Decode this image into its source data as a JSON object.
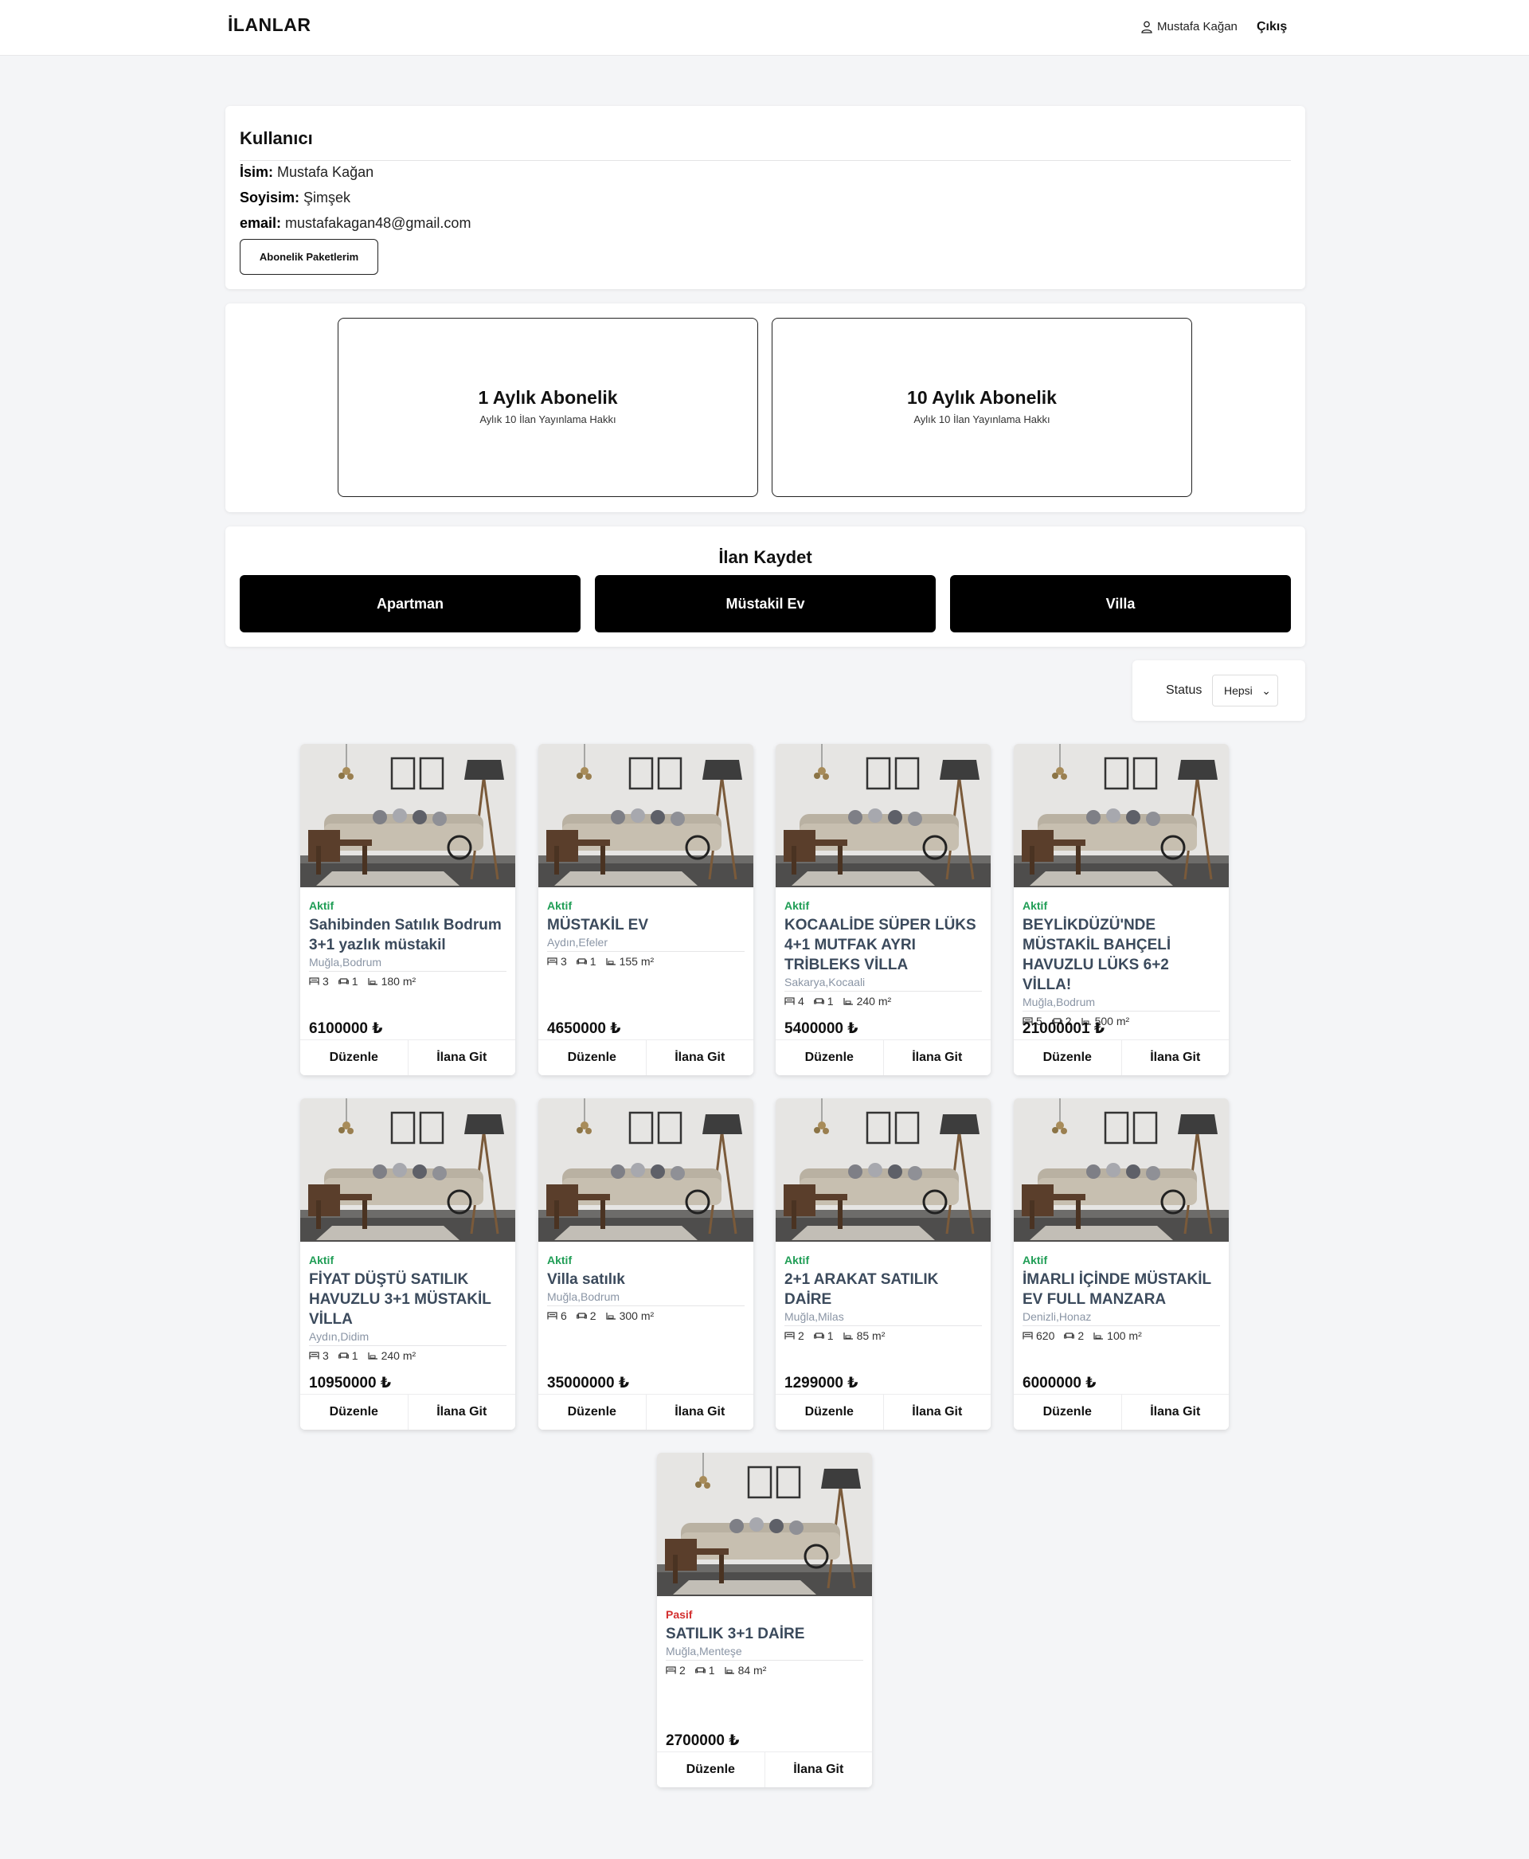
{
  "header": {
    "brand": "İLANLAR",
    "user_name": "Mustafa Kağan",
    "logout_label": "Çıkış"
  },
  "user": {
    "title": "Kullanıcı",
    "name_label": "İsim:",
    "name_value": "Mustafa Kağan",
    "surname_label": "Soyisim:",
    "surname_value": "Şimşek",
    "email_label": "email:",
    "email_value": "mustafakagan48@gmail.com",
    "packages_button": "Abonelik Paketlerim"
  },
  "plans": [
    {
      "title": "1 Aylık Abonelik",
      "subtitle": "Aylık 10 İlan Yayınlama Hakkı"
    },
    {
      "title": "10 Aylık Abonelik",
      "subtitle": "Aylık 10 İlan Yayınlama Hakkı"
    }
  ],
  "save": {
    "title": "İlan Kaydet",
    "types": [
      "Apartman",
      "Müstakil Ev",
      "Villa"
    ]
  },
  "filter": {
    "label": "Status",
    "selected": "Hepsi"
  },
  "card_actions": {
    "edit": "Düzenle",
    "goto": "İlana Git"
  },
  "listings": [
    {
      "status": "Aktif",
      "title": "Sahibinden Satılık Bodrum 3+1 yazlık müstakil",
      "location": "Muğla,Bodrum",
      "rooms": "3",
      "baths": "1",
      "area": "180 m²",
      "price": "6100000 ₺"
    },
    {
      "status": "Aktif",
      "title": "MÜSTAKİL EV",
      "location": "Aydın,Efeler",
      "rooms": "3",
      "baths": "1",
      "area": "155 m²",
      "price": "4650000 ₺"
    },
    {
      "status": "Aktif",
      "title": "KOCAALİDE SÜPER LÜKS 4+1 MUTFAK AYRI TRİBLEKS VİLLA",
      "location": "Sakarya,Kocaali",
      "rooms": "4",
      "baths": "1",
      "area": "240 m²",
      "price": "5400000 ₺"
    },
    {
      "status": "Aktif",
      "title": "BEYLİKDÜZÜ'NDE MÜSTAKİL BAHÇELİ HAVUZLU LÜKS 6+2 VİLLA!",
      "location": "Muğla,Bodrum",
      "rooms": "5",
      "baths": "2",
      "area": "500 m²",
      "price": "21000001 ₺"
    },
    {
      "status": "Aktif",
      "title": "FİYAT DÜŞTÜ SATILIK HAVUZLU 3+1 MÜSTAKİL VİLLA",
      "location": "Aydın,Didim",
      "rooms": "3",
      "baths": "1",
      "area": "240 m²",
      "price": "10950000 ₺"
    },
    {
      "status": "Aktif",
      "title": "Villa satılık",
      "location": "Muğla,Bodrum",
      "rooms": "6",
      "baths": "2",
      "area": "300 m²",
      "price": "35000000 ₺"
    },
    {
      "status": "Aktif",
      "title": "2+1 ARAKAT SATILIK DAİRE",
      "location": "Muğla,Milas",
      "rooms": "2",
      "baths": "1",
      "area": "85 m²",
      "price": "1299000 ₺"
    },
    {
      "status": "Aktif",
      "title": "İMARLI İÇİNDE MÜSTAKİL EV FULL MANZARA",
      "location": "Denizli,Honaz",
      "rooms": "620",
      "baths": "2",
      "area": "100 m²",
      "price": "6000000 ₺"
    },
    {
      "status": "Pasif",
      "title": "SATILIK 3+1 DAİRE",
      "location": "Muğla,Menteşe",
      "rooms": "2",
      "baths": "1",
      "area": "84 m²",
      "price": "2700000 ₺"
    }
  ]
}
